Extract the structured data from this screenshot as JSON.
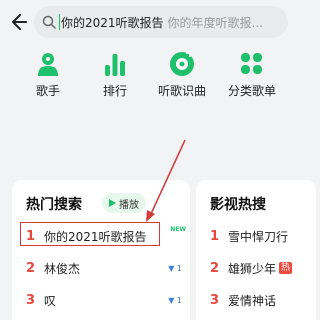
{
  "search": {
    "query": "你的2021听歌报告",
    "placeholder": "你的年度听歌报..."
  },
  "categories": [
    {
      "label": "歌手",
      "icon": "singer-icon"
    },
    {
      "label": "排行",
      "icon": "chart-icon"
    },
    {
      "label": "听歌识曲",
      "icon": "music-recognition-icon"
    },
    {
      "label": "分类歌单",
      "icon": "category-grid-icon"
    }
  ],
  "hot_search": {
    "title": "热门搜索",
    "play_label": "播放",
    "items": [
      {
        "rank": "1",
        "name": "你的2021听歌报告",
        "badge": "NEW"
      },
      {
        "rank": "2",
        "name": "林俊杰",
        "trend": "▼ 1"
      },
      {
        "rank": "3",
        "name": "叹",
        "trend": "▼ 1"
      }
    ]
  },
  "film_hot": {
    "title": "影视热搜",
    "items": [
      {
        "rank": "1",
        "name": "雪中悍刀行"
      },
      {
        "rank": "2",
        "name": "雄狮少年",
        "badge": "热"
      },
      {
        "rank": "3",
        "name": "爱情神话"
      }
    ]
  },
  "colors": {
    "accent": "#1fc06b",
    "rank": "#e8473f",
    "highlight": "#d43b3b"
  }
}
